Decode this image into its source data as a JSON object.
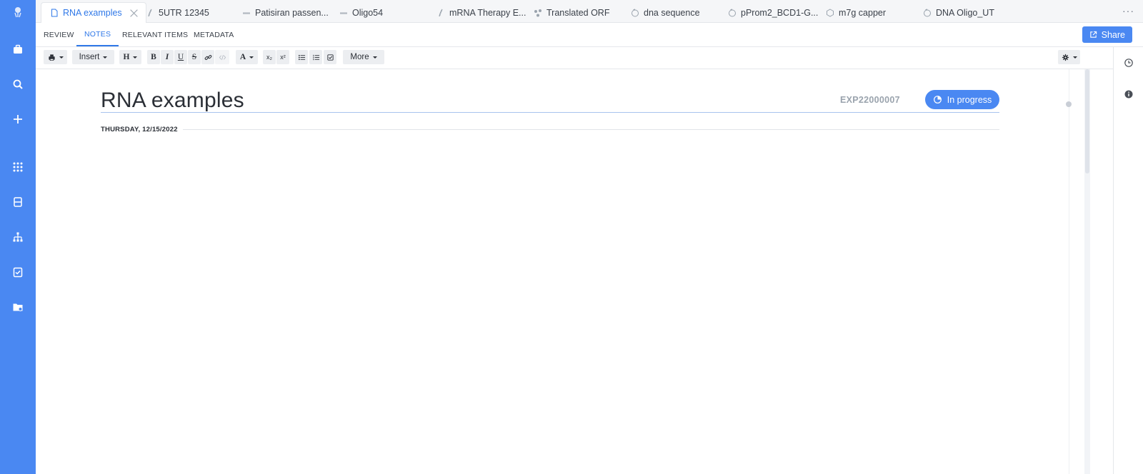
{
  "rail": {
    "items": [
      {
        "name": "logo-icon"
      },
      {
        "name": "briefcase-icon"
      },
      {
        "name": "search-icon"
      },
      {
        "name": "plus-icon"
      },
      {
        "name": "apps-grid-icon"
      },
      {
        "name": "inventory-icon"
      },
      {
        "name": "hierarchy-icon"
      },
      {
        "name": "tasks-icon"
      },
      {
        "name": "folder-icon"
      }
    ]
  },
  "tabs": [
    {
      "label": "RNA examples",
      "icon": "document-icon",
      "active": true
    },
    {
      "label": "5UTR 12345",
      "icon": "rna-icon"
    },
    {
      "label": "Patisiran passen...",
      "icon": "oligo-icon"
    },
    {
      "label": "Oligo54",
      "icon": "oligo-icon"
    },
    {
      "label": "mRNA Therapy E...",
      "icon": "rna-icon"
    },
    {
      "label": "Translated ORF",
      "icon": "molecule-icon"
    },
    {
      "label": "dna sequence",
      "icon": "plasmid-icon"
    },
    {
      "label": "pProm2_BCD1-G...",
      "icon": "plasmid-icon"
    },
    {
      "label": "m7g capper",
      "icon": "hexagon-icon"
    },
    {
      "label": "DNA Oligo_UT",
      "icon": "plasmid-icon"
    }
  ],
  "subnav": {
    "items": [
      "REVIEW",
      "NOTES",
      "RELEVANT ITEMS",
      "METADATA"
    ],
    "active": "NOTES",
    "share_label": "Share"
  },
  "toolbar": {
    "insert_label": "Insert",
    "heading_label": "H",
    "bold": "B",
    "italic": "I",
    "underline": "U",
    "strike": "S",
    "font_color": "A",
    "subscript": "x₂",
    "superscript": "x²",
    "more_label": "More"
  },
  "document": {
    "title": "RNA examples",
    "id": "EXP22000007",
    "status": "In progress",
    "date": "THURSDAY, 12/15/2022"
  },
  "colors": {
    "accent": "#4a88f2",
    "active_text": "#2f78e8"
  }
}
